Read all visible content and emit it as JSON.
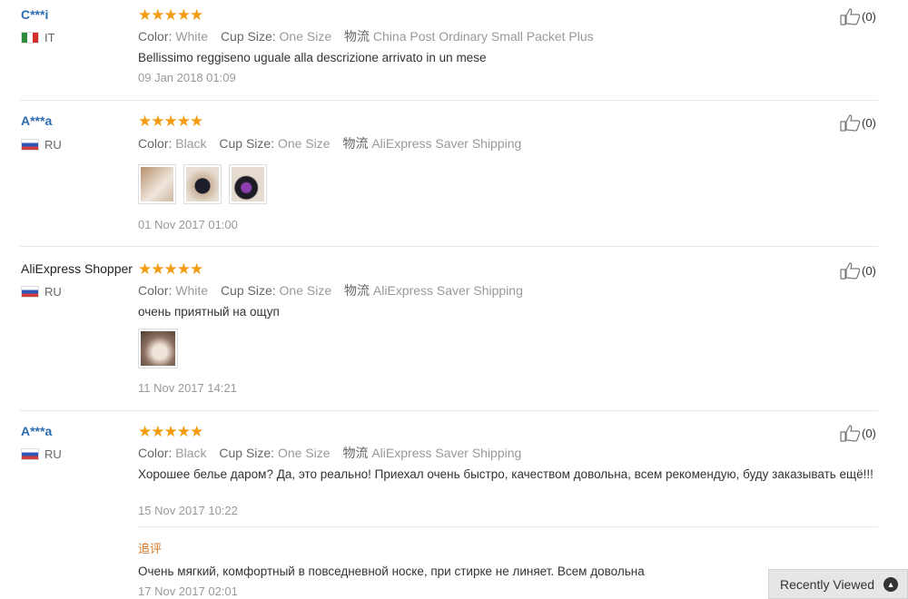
{
  "reviews": [
    {
      "user": "C***i",
      "country": "IT",
      "stars": "★★★★★",
      "color_label": "Color:",
      "color": "White",
      "cup_label": "Cup Size:",
      "cup": "One Size",
      "ship_label": "物流",
      "ship": "China Post Ordinary Small Packet Plus",
      "text": "Bellissimo reggiseno uguale alla descrizione arrivato in un mese",
      "date": "09 Jan 2018 01:09",
      "likes": "(0)"
    },
    {
      "user": "A***a",
      "country": "RU",
      "stars": "★★★★★",
      "color_label": "Color:",
      "color": "Black",
      "cup_label": "Cup Size:",
      "cup": "One Size",
      "ship_label": "物流",
      "ship": "AliExpress Saver Shipping",
      "date": "01 Nov 2017 01:00",
      "likes": "(0)"
    },
    {
      "user": "AliExpress Shopper",
      "country": "RU",
      "stars": "★★★★★",
      "color_label": "Color:",
      "color": "White",
      "cup_label": "Cup Size:",
      "cup": "One Size",
      "ship_label": "物流",
      "ship": "AliExpress Saver Shipping",
      "text": "очень приятный на ощуп",
      "date": "11 Nov 2017 14:21",
      "likes": "(0)"
    },
    {
      "user": "A***a",
      "country": "RU",
      "stars": "★★★★★",
      "color_label": "Color:",
      "color": "Black",
      "cup_label": "Cup Size:",
      "cup": "One Size",
      "ship_label": "物流",
      "ship": "AliExpress Saver Shipping",
      "text": "Хорошее белье даром? Да, это реально! Приехал очень быстро, качеством довольна, всем рекомендую, буду заказывать ещё!!!",
      "date": "15 Nov 2017 10:22",
      "likes": "(0)",
      "followup_label": "追评",
      "followup_text": "Очень мягкий, комфортный в повседневной носке, при стирке не линяет. Всем довольна",
      "followup_date": "17 Nov 2017 02:01"
    }
  ],
  "recently_viewed": "Recently Viewed",
  "icons": {
    "like": "thumbs-up-icon",
    "recent_toggle": "chevron-up-icon"
  },
  "colors": {
    "star": "#f39c12",
    "username": "#2d6bb2",
    "followup": "#d4762a"
  }
}
